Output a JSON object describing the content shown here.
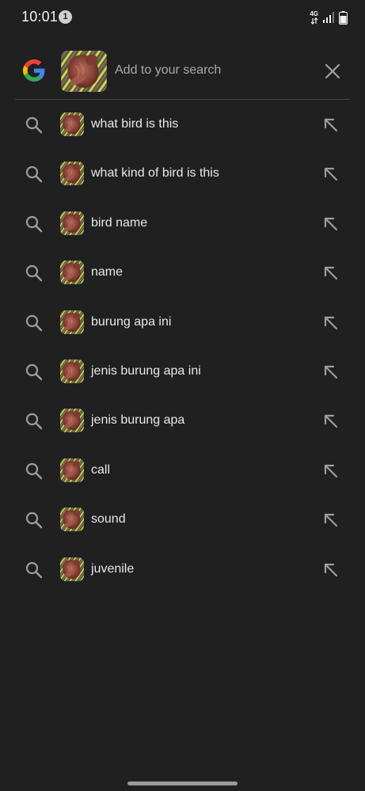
{
  "status_bar": {
    "time": "10:01",
    "notification_count": "1",
    "network_type": "4G"
  },
  "search": {
    "placeholder": "Add to your search",
    "lens_image_icon": "bird-photo-thumbnail",
    "close_icon": "close-icon",
    "logo_icon": "google-g-logo"
  },
  "suggestions": [
    {
      "text": "what bird is this"
    },
    {
      "text": "what kind of bird is this"
    },
    {
      "text": "bird name"
    },
    {
      "text": "name"
    },
    {
      "text": "burung apa ini"
    },
    {
      "text": "jenis burung apa ini"
    },
    {
      "text": "jenis burung apa"
    },
    {
      "text": "call"
    },
    {
      "text": "sound"
    },
    {
      "text": "juvenile"
    }
  ],
  "colors": {
    "background": "#202020",
    "text": "#e8e8e8",
    "placeholder": "#a9a9a9",
    "icon": "#9e9e9e",
    "divider": "#4a4a4a"
  }
}
